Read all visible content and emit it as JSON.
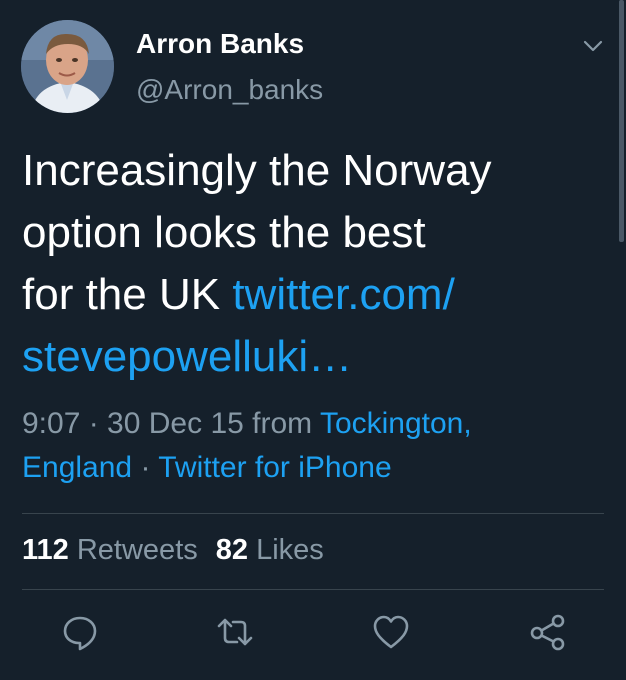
{
  "author": {
    "display_name": "Arron Banks",
    "handle": "@Arron_banks"
  },
  "tweet": {
    "text_lines": [
      "Increasingly the Norway",
      "option looks the best",
      "for the UK "
    ],
    "link_part1": "twitter.com/",
    "link_part2": "stevepowelluki…"
  },
  "meta": {
    "time_date": "9:07 · 30 Dec 15 from ",
    "location_part1": "Tockington,",
    "location_part2": "England",
    "separator": " · ",
    "source": "Twitter for iPhone"
  },
  "stats": {
    "retweets_count": "112",
    "retweets_label": "Retweets",
    "likes_count": "82",
    "likes_label": "Likes"
  },
  "icons": {
    "menu": "chevron-down-icon",
    "reply": "reply-icon",
    "retweet": "retweet-icon",
    "like": "heart-icon",
    "share": "share-icon"
  },
  "colors": {
    "background": "#15202b",
    "text": "#ffffff",
    "secondary": "#8899a6",
    "link": "#1da1f2",
    "divider": "#38444d"
  }
}
